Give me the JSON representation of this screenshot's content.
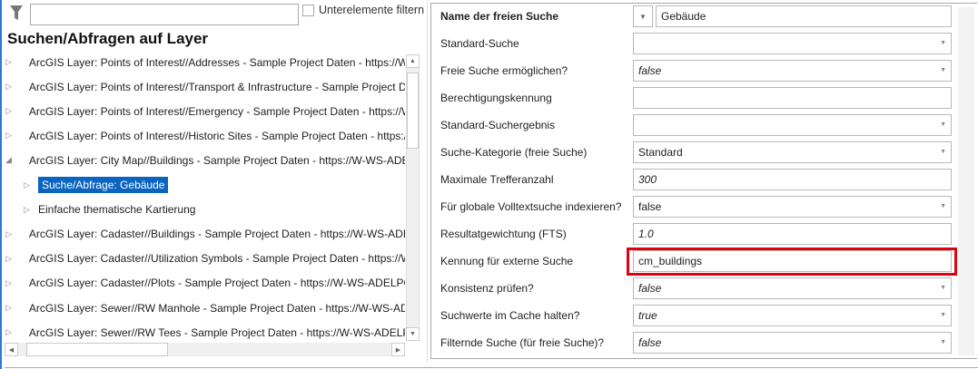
{
  "filter": {
    "placeholder": "",
    "checkbox_label": "Unterelemente filtern",
    "checked": false
  },
  "tree": {
    "title": "Suchen/Abfragen auf Layer",
    "items": [
      {
        "label": "ArcGIS Layer: Points of Interest//Addresses - Sample Project Daten - https://W-WS-ADELPOLL",
        "level": 0,
        "expanded": false,
        "status_color": "#1aae2e"
      },
      {
        "label": "ArcGIS Layer: Points of Interest//Transport & Infrastructure - Sample Project Daten",
        "level": 0,
        "expanded": false,
        "status_color": "#1aae2e"
      },
      {
        "label": "ArcGIS Layer: Points of Interest//Emergency - Sample Project Daten - https://W-WS-ADELPOLL",
        "level": 0,
        "expanded": false,
        "status_color": "#1aae2e"
      },
      {
        "label": "ArcGIS Layer: Points of Interest//Historic Sites - Sample Project Daten - https://W-WS-ADELPOLL",
        "level": 0,
        "expanded": false,
        "status_color": "#1aae2e"
      },
      {
        "label": "ArcGIS Layer: City Map//Buildings - Sample Project Daten - https://W-WS-ADELPOLL",
        "level": 0,
        "expanded": true,
        "status_color": "#1aae2e"
      },
      {
        "label": "Suche/Abfrage: Gebäude",
        "level": 1,
        "expanded": false,
        "selected": true
      },
      {
        "label": "Einfache thematische Kartierung",
        "level": 1,
        "expanded": false
      },
      {
        "label": "ArcGIS Layer: Cadaster//Buildings - Sample Project Daten - https://W-WS-ADELPOLL",
        "level": 0,
        "expanded": false,
        "status_color": "#1aae2e"
      },
      {
        "label": "ArcGIS Layer: Cadaster//Utilization Symbols - Sample Project Daten - https://W-WS-ADELPOLL",
        "level": 0,
        "expanded": false,
        "status_color": "#1aae2e"
      },
      {
        "label": "ArcGIS Layer: Cadaster//Plots - Sample Project Daten - https://W-WS-ADELPOLL.sys",
        "level": 0,
        "expanded": false,
        "status_color": "#1aae2e"
      },
      {
        "label": "ArcGIS Layer: Sewer//RW Manhole - Sample Project Daten - https://W-WS-ADELPOLL",
        "level": 0,
        "expanded": false,
        "status_color": "#1aae2e"
      },
      {
        "label": "ArcGIS Layer: Sewer//RW Tees - Sample Project Daten - https://W-WS-ADELPOLL.sys",
        "level": 0,
        "expanded": false,
        "status_color": "#1aae2e"
      }
    ]
  },
  "properties": {
    "name": {
      "label": "Name der freien Suche",
      "value": "Gebäude"
    },
    "rows": [
      {
        "label": "Standard-Suche",
        "value": "",
        "type": "dropdown",
        "italic": false
      },
      {
        "label": "Freie Suche ermöglichen?",
        "value": "false",
        "type": "dropdown",
        "italic": true
      },
      {
        "label": "Berechtigungskennung",
        "value": "",
        "type": "text",
        "italic": false
      },
      {
        "label": "Standard-Suchergebnis",
        "value": "",
        "type": "dropdown",
        "italic": false
      },
      {
        "label": "Suche-Kategorie (freie Suche)",
        "value": "Standard",
        "type": "dropdown",
        "italic": false
      },
      {
        "label": "Maximale Trefferanzahl",
        "value": "300",
        "type": "text",
        "italic": true
      },
      {
        "label": "Für globale Volltextsuche indexieren?",
        "value": "false",
        "type": "dropdown",
        "italic": false
      },
      {
        "label": "Resultatgewichtung (FTS)",
        "value": "1.0",
        "type": "text",
        "italic": true
      },
      {
        "label": "Kennung für externe Suche",
        "value": "cm_buildings",
        "type": "text",
        "italic": false,
        "highlighted": true
      },
      {
        "label": "Konsistenz prüfen?",
        "value": "false",
        "type": "dropdown",
        "italic": true
      },
      {
        "label": "Suchwerte im Cache halten?",
        "value": "true",
        "type": "dropdown",
        "italic": true
      },
      {
        "label": "Filternde Suche (für freie Suche)?",
        "value": "false",
        "type": "dropdown",
        "italic": true
      }
    ],
    "highlight_color": "#e0000f"
  }
}
